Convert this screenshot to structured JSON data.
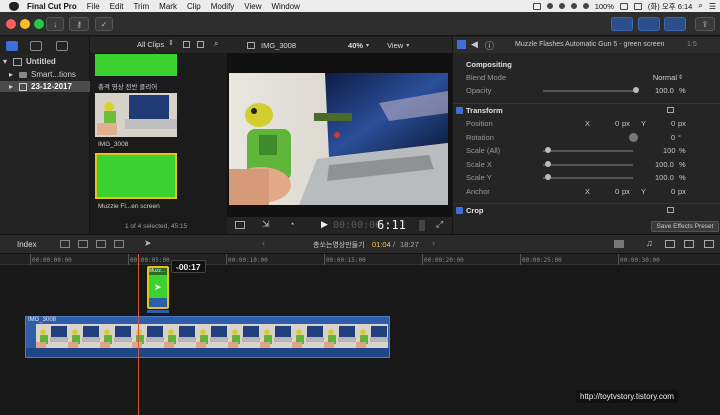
{
  "menubar": {
    "app_name": "Final Cut Pro",
    "items": [
      "File",
      "Edit",
      "Trim",
      "Mark",
      "Clip",
      "Modify",
      "View",
      "Window"
    ],
    "battery": "100%",
    "clock": "(화) 오후 6:14"
  },
  "sidebar": {
    "library": "Untitled",
    "smart": "Smart...tions",
    "event": "23-12-2017"
  },
  "browser": {
    "filter": "All Clips",
    "clip1_name": "총격 영상 전반 클리어",
    "clip2_name": "IMG_3008",
    "clip3_name": "Muzzle Fl...en screen",
    "selection_status": "1 of 4 selected, 45:15"
  },
  "viewer": {
    "clip_name": "IMG_3008",
    "zoom": "40%",
    "view_label": "View",
    "timecode_dim": "00:00:00",
    "timecode_bright": "6:11"
  },
  "inspector": {
    "title": "Muzzle Flashes Automatic Gun 5 - green screen",
    "extra": "1:5",
    "compositing": "Compositing",
    "blend_mode_label": "Blend Mode",
    "blend_mode_value": "Normal",
    "opacity_label": "Opacity",
    "opacity_value": "100.0",
    "opacity_unit": "%",
    "transform": "Transform",
    "position_label": "Position",
    "rotation_label": "Rotation",
    "scale_all_label": "Scale (All)",
    "scale_x_label": "Scale X",
    "scale_y_label": "Scale Y",
    "anchor_label": "Anchor",
    "x_label": "X",
    "y_label": "Y",
    "pos_x": "0",
    "pos_y": "0",
    "px": "px",
    "rotation_value": "0",
    "rotation_unit": "°",
    "scale_all_value": "100",
    "scale_x_value": "100.0",
    "scale_y_value": "100.0",
    "anchor_x": "0",
    "anchor_y": "0",
    "crop": "Crop",
    "save_preset": "Save Effects Preset"
  },
  "timeline_header": {
    "index": "Index",
    "project_name": "총쏘는영상만들기",
    "current_time": "01:04",
    "total_time": "18:27"
  },
  "ruler": {
    "ticks": [
      "00:00:00:00",
      "00:00:05:00",
      "00:00:10:00",
      "00:00:15:00",
      "00:00:20:00",
      "00:00:25:00",
      "00:00:30:00"
    ]
  },
  "timeline": {
    "connected_clip_label": "Muzz...",
    "drag_offset": "-00:17",
    "primary_clip_label": "IMG_3008"
  },
  "watermark": "http://toytvstory.tistory.com",
  "colors": {
    "green_screen": "#3bd12f",
    "selection_yellow": "#e6c21a",
    "primary_clip_blue": "#2f5ea8",
    "playhead": "#d8533a",
    "accent_blue": "#3c70d8",
    "timecode_highlight": "#f5c542"
  }
}
